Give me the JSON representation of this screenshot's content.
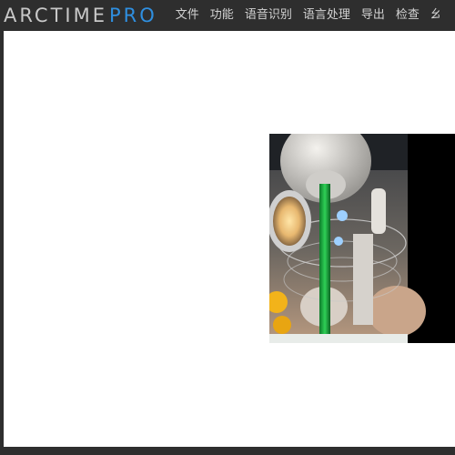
{
  "app": {
    "logo_main": "ARCTIME",
    "logo_pro": "PRO"
  },
  "menu": {
    "items": [
      {
        "label": "文件"
      },
      {
        "label": "功能"
      },
      {
        "label": "语音识别"
      },
      {
        "label": "语言处理"
      },
      {
        "label": "导出"
      },
      {
        "label": "检查"
      },
      {
        "label": "幺"
      }
    ]
  },
  "colors": {
    "menubar_bg": "#2e2e2e",
    "logo_accent": "#2f8fe0",
    "canvas_bg": "#ffffff",
    "video_letterbox": "#000000"
  },
  "preview": {
    "icon": "video-frame"
  }
}
